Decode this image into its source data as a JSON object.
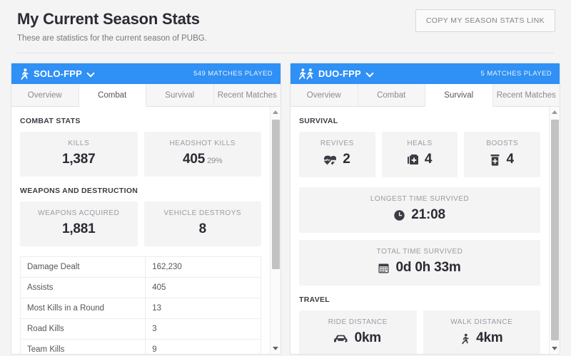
{
  "header": {
    "title": "My Current Season Stats",
    "subtitle": "These are statistics for the current season of PUBG.",
    "copy_button": "COPY MY SEASON STATS LINK"
  },
  "accent_color": "#2f90f5",
  "panels": [
    {
      "mode": "SOLO-FPP",
      "mode_icon": "runner-icon",
      "matches": "549 MATCHES PLAYED",
      "tabs": [
        {
          "label": "Overview",
          "active": false
        },
        {
          "label": "Combat",
          "active": true
        },
        {
          "label": "Survival",
          "active": false
        },
        {
          "label": "Recent Matches",
          "active": false
        }
      ],
      "sections": [
        {
          "title": "COMBAT STATS",
          "cards": [
            {
              "label": "KILLS",
              "value": "1,387",
              "suffix": "",
              "icon": ""
            },
            {
              "label": "HEADSHOT KILLS",
              "value": "405",
              "suffix": "29%",
              "icon": ""
            }
          ]
        },
        {
          "title": "WEAPONS AND DESTRUCTION",
          "cards": [
            {
              "label": "WEAPONS ACQUIRED",
              "value": "1,881",
              "suffix": "",
              "icon": ""
            },
            {
              "label": "VEHICLE DESTROYS",
              "value": "8",
              "suffix": "",
              "icon": ""
            }
          ]
        }
      ],
      "table": [
        {
          "key": "Damage Dealt",
          "value": "162,230"
        },
        {
          "key": "Assists",
          "value": "405"
        },
        {
          "key": "Most Kills in a Round",
          "value": "13"
        },
        {
          "key": "Road Kills",
          "value": "3"
        },
        {
          "key": "Team Kills",
          "value": "9"
        }
      ]
    },
    {
      "mode": "DUO-FPP",
      "mode_icon": "duo-runner-icon",
      "matches": "5 MATCHES PLAYED",
      "tabs": [
        {
          "label": "Overview",
          "active": false
        },
        {
          "label": "Combat",
          "active": false
        },
        {
          "label": "Survival",
          "active": true
        },
        {
          "label": "Recent Matches",
          "active": false
        }
      ],
      "sections": [
        {
          "title": "SURVIVAL",
          "cards": [
            {
              "label": "REVIVES",
              "value": "2",
              "suffix": "",
              "icon": "heartbeat-icon"
            },
            {
              "label": "HEALS",
              "value": "4",
              "suffix": "",
              "icon": "medkit-icon"
            },
            {
              "label": "BOOSTS",
              "value": "4",
              "suffix": "",
              "icon": "pill-bottle-icon"
            }
          ]
        }
      ],
      "wide_cards": [
        {
          "label": "LONGEST TIME SURVIVED",
          "value": "21:08",
          "icon": "clock-icon"
        },
        {
          "label": "TOTAL TIME SURVIVED",
          "value": "0d 0h 33m",
          "icon": "calendar-icon"
        }
      ],
      "travel": {
        "title": "TRAVEL",
        "cards": [
          {
            "label": "RIDE DISTANCE",
            "value": "0km",
            "icon": "car-icon"
          },
          {
            "label": "WALK DISTANCE",
            "value": "4km",
            "icon": "walk-icon"
          }
        ]
      }
    }
  ]
}
